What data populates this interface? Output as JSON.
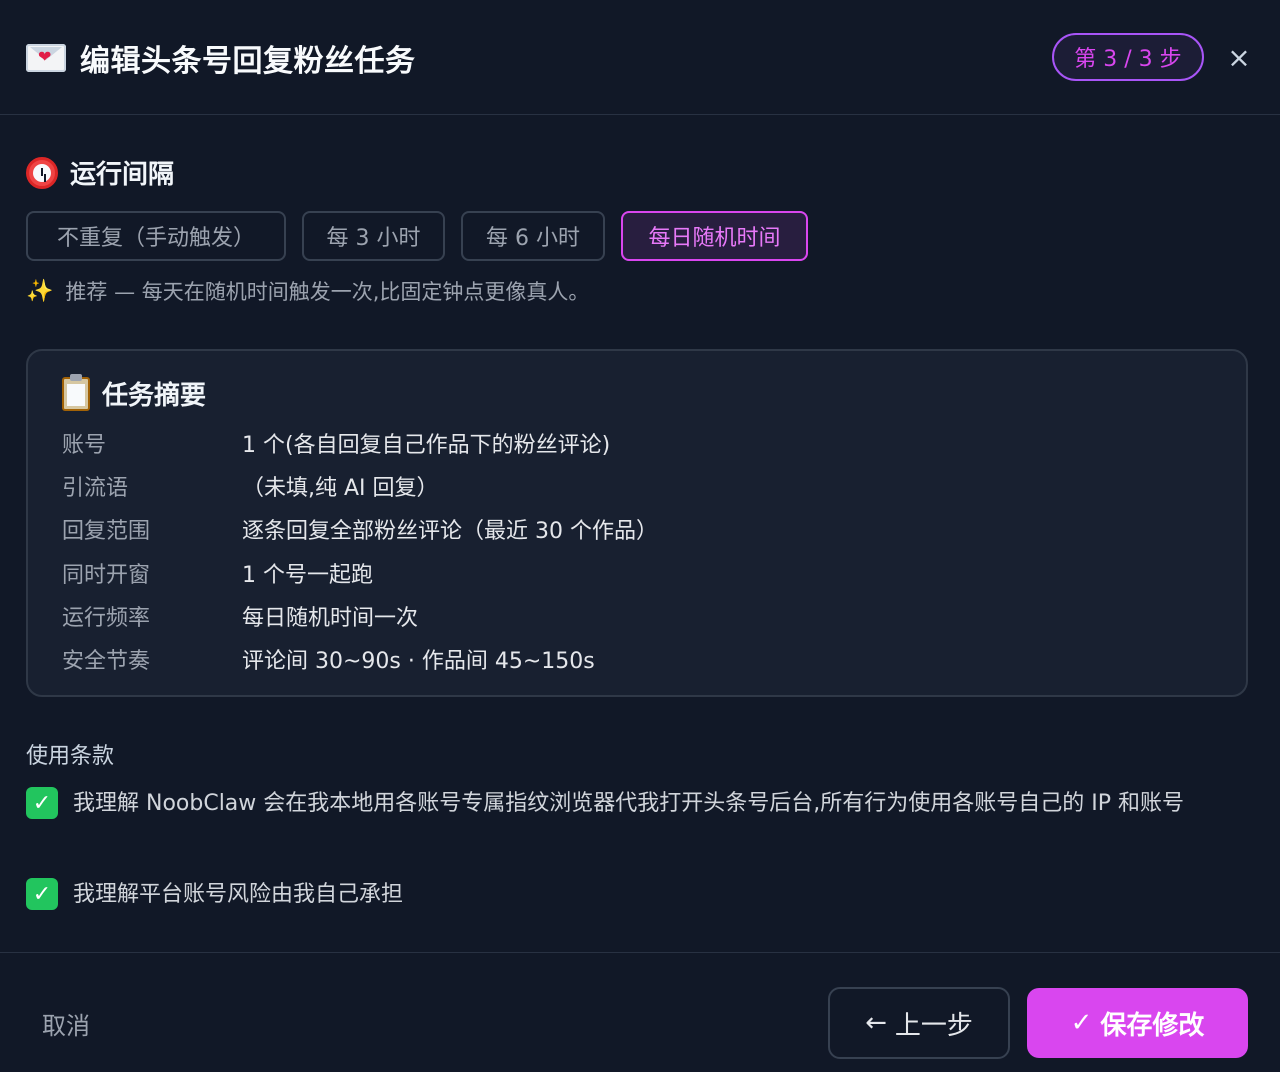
{
  "header": {
    "title": "编辑头条号回复粉丝任务",
    "step": "第 3 / 3 步",
    "close": "×"
  },
  "interval": {
    "title": "运行间隔",
    "options": [
      "不重复（手动触发）",
      "每 3 小时",
      "每 6 小时",
      "每日随机时间"
    ],
    "selected": "每日随机时间",
    "hint": "推荐 — 每天在随机时间触发一次,比固定钟点更像真人。"
  },
  "summary": {
    "title": "任务摘要",
    "rows": [
      {
        "key": "账号",
        "value": "1 个(各自回复自己作品下的粉丝评论)"
      },
      {
        "key": "引流语",
        "value": "（未填,纯 AI 回复）"
      },
      {
        "key": "回复范围",
        "value": "逐条回复全部粉丝评论（最近 30 个作品）"
      },
      {
        "key": "同时开窗",
        "value": "1 个号一起跑"
      },
      {
        "key": "运行频率",
        "value": "每日随机时间一次"
      },
      {
        "key": "安全节奏",
        "value": "评论间 30~90s · 作品间 45~150s"
      }
    ]
  },
  "terms": {
    "title": "使用条款",
    "items": [
      {
        "text": "我理解 NoobClaw 会在我本地用各账号专属指纹浏览器代我打开头条号后台,所有行为使用各账号自己的 IP 和账号",
        "checked": true
      },
      {
        "text": "我理解平台账号风险由我自己承担",
        "checked": true
      }
    ]
  },
  "footer": {
    "cancel": "取消",
    "prev": "上一步",
    "save": "保存修改"
  },
  "icons": {
    "title": "love-letter-icon",
    "interval": "alarm-clock-icon",
    "hint": "sparkles-icon",
    "summary": "clipboard-icon",
    "check": "check-icon",
    "prev": "arrow-left-icon"
  },
  "colors": {
    "background": "#111827",
    "accent": "#d946ef",
    "check": "#22c55e"
  }
}
